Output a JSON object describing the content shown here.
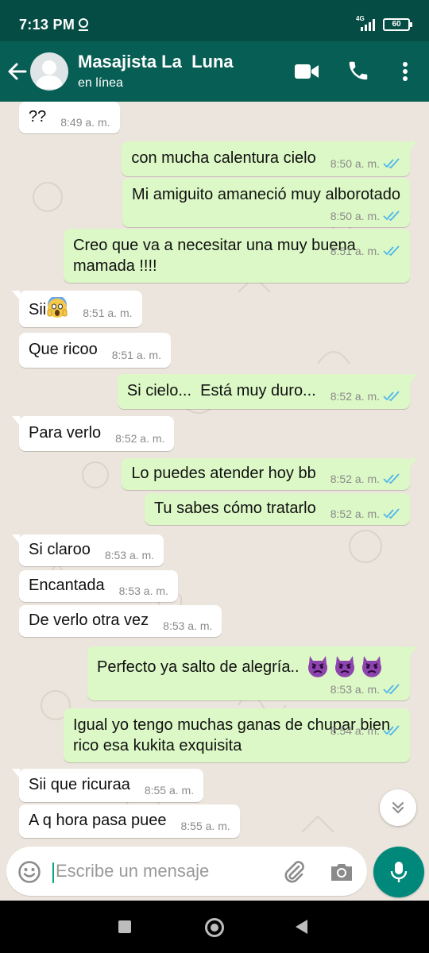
{
  "status_bar": {
    "time": "7:13 PM",
    "network": "4G",
    "battery": "60"
  },
  "header": {
    "contact_name": "Masajista La  Luna",
    "contact_status": "en línea"
  },
  "messages": [
    {
      "dir": "in",
      "text": "??",
      "time": "8:49 a. m."
    },
    {
      "dir": "out",
      "text": "con mucha calentura cielo",
      "time": "8:50 a. m.",
      "read": true
    },
    {
      "dir": "out",
      "text": "Mi amiguito amaneció muy alborotado",
      "time": "8:50 a. m.",
      "read": true
    },
    {
      "dir": "out",
      "text": "Creo que va a necesitar una muy buena mamada !!!!",
      "time": "8:51 a. m.",
      "read": true
    },
    {
      "dir": "in",
      "text": "Sii",
      "emoji": "face-screaming-in-fear",
      "time": "8:51 a. m."
    },
    {
      "dir": "in",
      "text": "Que ricoo",
      "time": "8:51 a. m."
    },
    {
      "dir": "out",
      "text": "Si cielo...  Está muy duro...",
      "time": "8:52 a. m.",
      "read": true
    },
    {
      "dir": "in",
      "text": "Para verlo",
      "time": "8:52 a. m."
    },
    {
      "dir": "out",
      "text": "Lo puedes atender hoy bb",
      "time": "8:52 a. m.",
      "read": true
    },
    {
      "dir": "out",
      "text": "Tu sabes cómo tratarlo",
      "time": "8:52 a. m.",
      "read": true
    },
    {
      "dir": "in",
      "text": "Si claroo",
      "time": "8:53 a. m."
    },
    {
      "dir": "in",
      "text": "Encantada",
      "time": "8:53 a. m."
    },
    {
      "dir": "in",
      "text": "De verlo otra vez",
      "time": "8:53 a. m."
    },
    {
      "dir": "out",
      "text": "Perfecto ya salto de alegría..",
      "emoji": "angry-devil-x3",
      "time": "8:53 a. m.",
      "read": true
    },
    {
      "dir": "out",
      "text": "Igual yo tengo muchas ganas de chupar bien rico esa kukita exquisita",
      "time": "8:54 a. m.",
      "read": true
    },
    {
      "dir": "in",
      "text": "Sii que ricuraa",
      "time": "8:55 a. m."
    },
    {
      "dir": "in",
      "text": "A q hora pasa puee",
      "time": "8:55 a. m."
    }
  ],
  "composer": {
    "placeholder": "Escribe un mensaje"
  },
  "icons": {
    "back": "arrow-left-icon",
    "video": "video-call-icon",
    "call": "phone-icon",
    "menu": "more-vert-icon",
    "emoji": "emoji-icon",
    "attach": "paperclip-icon",
    "camera": "camera-icon",
    "mic": "mic-icon",
    "scroll": "double-chevron-down-icon",
    "read_ticks": "double-check-icon"
  },
  "colors": {
    "header": "#075e54",
    "status_bar": "#054d44",
    "chat_bg": "#ece5dd",
    "incoming_bubble": "#ffffff",
    "outgoing_bubble": "#dcf8c6",
    "read_ticks": "#4fb6ec",
    "mic_button": "#00897b"
  }
}
